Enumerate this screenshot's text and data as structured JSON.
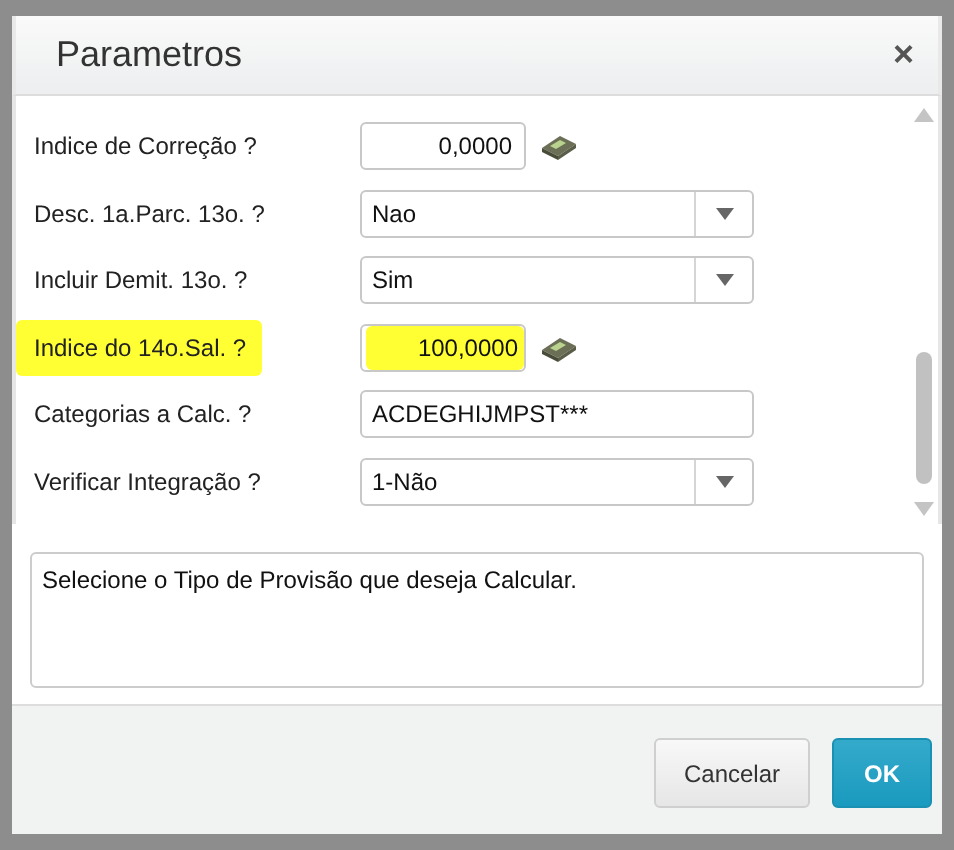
{
  "dialog": {
    "title": "Parametros",
    "close": "×"
  },
  "fields": [
    {
      "label": "Indice de Correção ?",
      "kind": "number",
      "value": "0,0000",
      "highlighted": false
    },
    {
      "label": "Desc. 1a.Parc. 13o. ?",
      "kind": "select",
      "value": "Nao",
      "highlighted": false
    },
    {
      "label": "Incluir Demit. 13o. ?",
      "kind": "select",
      "value": "Sim",
      "highlighted": false
    },
    {
      "label": "Indice do 14o.Sal. ?",
      "kind": "number",
      "value": "100,0000",
      "highlighted": true
    },
    {
      "label": "Categorias a Calc. ?",
      "kind": "text",
      "value": "ACDEGHIJMPST***",
      "highlighted": false
    },
    {
      "label": "Verificar Integração ?",
      "kind": "select",
      "value": "1-Não",
      "highlighted": false
    }
  ],
  "description": "Selecione o Tipo de Provisão que deseja Calcular.",
  "buttons": [
    {
      "label": "Cancelar",
      "kind": "secondary"
    },
    {
      "label": "OK",
      "kind": "primary"
    }
  ]
}
